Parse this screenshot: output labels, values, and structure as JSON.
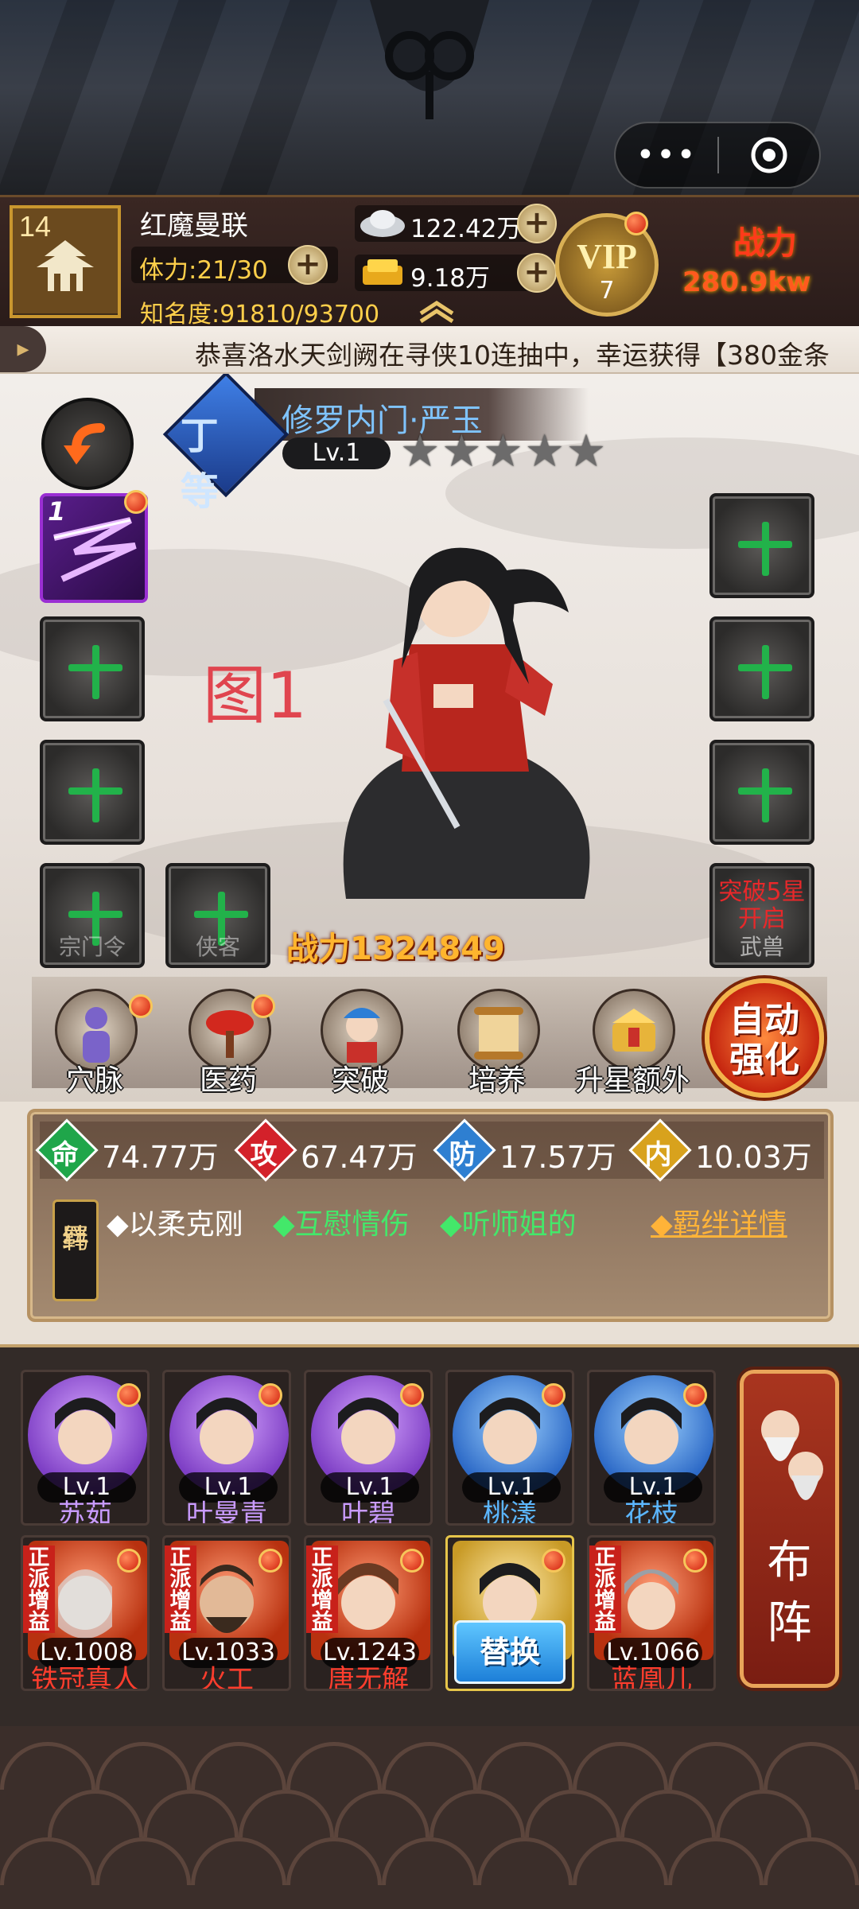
{
  "top_menu": {
    "more_label": "•••",
    "icons": [
      "more-dots-icon",
      "target-icon"
    ]
  },
  "player": {
    "level": "14",
    "name": "红魔曼联",
    "stamina": "体力:21/30",
    "fame": "知名度:91810/93700",
    "silver": "122.42万",
    "gold": "9.18万",
    "vip_label": "VIP",
    "vip_level": "7",
    "power_label": "战力",
    "power_value": "280.9kw"
  },
  "marquee": {
    "text": "恭喜洛水天剑阙在寻侠10连抽中，幸运获得【380金条"
  },
  "hero": {
    "grade": "丁等",
    "name": "修罗内门·严玉",
    "level": "Lv.1",
    "stars": [
      "★",
      "★",
      "★",
      "★",
      "★"
    ],
    "annotation": "图1",
    "skill_slot_count": "1",
    "slot_sect_token": "宗门令",
    "slot_companion": "侠客",
    "slot_beast_lock": "突破5星开启",
    "slot_beast": "武兽",
    "power": "战力1324849"
  },
  "functions": [
    {
      "label": "穴脉",
      "icon": "meridian-icon"
    },
    {
      "label": "医药",
      "icon": "medicine-icon"
    },
    {
      "label": "突破",
      "icon": "breakthrough-icon"
    },
    {
      "label": "培养",
      "icon": "training-scroll-icon"
    },
    {
      "label": "升星额外",
      "icon": "star-upgrade-icon"
    }
  ],
  "auto_strengthen": {
    "line1": "自动",
    "line2": "强化"
  },
  "stats": [
    {
      "key": "命",
      "value": "74.77万",
      "color": "#1fa64a"
    },
    {
      "key": "攻",
      "value": "67.47万",
      "color": "#d3212a"
    },
    {
      "key": "防",
      "value": "17.57万",
      "color": "#2e7fd1"
    },
    {
      "key": "内",
      "value": "10.03万",
      "color": "#d8a21d"
    }
  ],
  "bonds": {
    "tag_line1": "羁",
    "tag_line2": "绊",
    "items": [
      "◆以柔克刚",
      "◆互慰情伤",
      "◆听师姐的"
    ],
    "detail": "◆羁绊详情"
  },
  "team": {
    "row1": [
      {
        "lv": "Lv.1",
        "name": "苏茹",
        "tone": "purple"
      },
      {
        "lv": "Lv.1",
        "name": "叶曼青",
        "tone": "purple"
      },
      {
        "lv": "Lv.1",
        "name": "叶碧",
        "tone": "purple"
      },
      {
        "lv": "Lv.1",
        "name": "桃漾",
        "tone": "blue"
      },
      {
        "lv": "Lv.1",
        "name": "花枝",
        "tone": "blue"
      }
    ],
    "row2": [
      {
        "lv": "Lv.1008",
        "name": "铁冠真人",
        "tag": "正派增益"
      },
      {
        "lv": "Lv.1033",
        "name": "火工",
        "tag": "正派增益"
      },
      {
        "lv": "Lv.1243",
        "name": "唐无解",
        "tag": "正派增益"
      },
      {
        "swap": "替换"
      },
      {
        "lv": "Lv.1066",
        "name": "蓝凰儿",
        "tag": "正派增益"
      }
    ],
    "formation": {
      "line1": "布",
      "line2": "阵"
    }
  }
}
